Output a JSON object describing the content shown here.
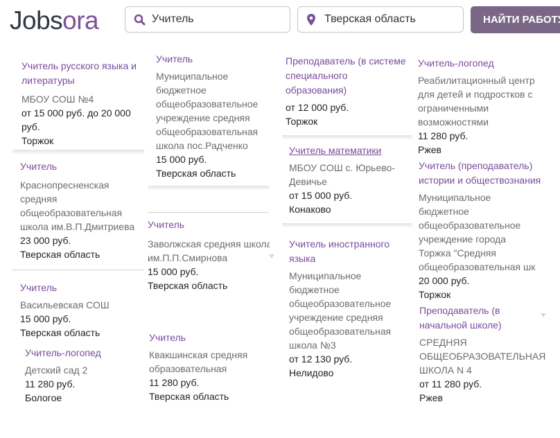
{
  "header": {
    "logo_part1": "Jobs",
    "logo_part2": "ora",
    "search_value": "Учитель",
    "location_value": "Тверская область",
    "find_button": "НАЙТИ РАБОТУ"
  },
  "columns": [
    [
      {
        "title_lines": [
          "Учитель русского языка и",
          "литературы"
        ],
        "org_lines": [
          "МБОУ СОШ №4"
        ],
        "salary_lines": [
          "от 15 000 руб. до 20 000",
          "руб."
        ],
        "city": "Торжок"
      },
      {
        "title_lines": [
          "Учитель"
        ],
        "org_lines": [
          "Краснопресненская",
          "средняя",
          "общеобразовательная",
          "школа им.В.П.Дмитриева"
        ],
        "salary_lines": [
          "23 000 руб."
        ],
        "city": "Тверская область"
      },
      {
        "title_lines": [
          "Учитель"
        ],
        "org_lines": [
          "Васильевская СОШ"
        ],
        "salary_lines": [
          "15 000 руб."
        ],
        "city": "Тверская область"
      },
      {
        "title_lines": [
          "Учитель-логопед"
        ],
        "org_lines": [
          "Детский сад 2"
        ],
        "salary_lines": [
          "11 280 руб."
        ],
        "city": "Бологое"
      }
    ],
    [
      {
        "title_lines": [
          "Учитель"
        ],
        "org_lines": [
          "Муниципальное",
          "бюджетное",
          "общеобразовательное",
          "учреждение средняя",
          "общеобразовательная",
          "школа пос.Радченко"
        ],
        "salary_lines": [
          "15 000 руб."
        ],
        "city": "Тверская область"
      },
      {
        "title_lines": [
          "Учитель"
        ],
        "org_lines": [
          "Заволжская средняя школа",
          "им.П.П.Смирнова"
        ],
        "salary_lines": [
          "15 000 руб."
        ],
        "city": "Тверская область"
      },
      {
        "title_lines": [
          "Учитель"
        ],
        "org_lines": [
          "Квакшинская средняя",
          "образовательная"
        ],
        "salary_lines": [
          "11 280 руб."
        ],
        "city": "Тверская область"
      }
    ],
    [
      {
        "title_lines": [
          "Преподаватель (в системе",
          "специального",
          "образования)"
        ],
        "org_lines": [],
        "salary_lines": [
          "от 12 000 руб."
        ],
        "city": "Торжок"
      },
      {
        "title_lines": [
          "Учитель математики"
        ],
        "org_lines": [
          "МБОУ СОШ с. Юрьево-",
          "Девичье"
        ],
        "salary_lines": [
          "от 15 000 руб."
        ],
        "city": "Конаково"
      },
      {
        "title_lines": [
          "Учитель иностранного",
          "языка"
        ],
        "org_lines": [
          "Муниципальное",
          "бюджетное",
          "общеобразовательное",
          "учреждение средняя",
          "общеобразовательная",
          "школа №3"
        ],
        "salary_lines": [
          "от 12 130 руб."
        ],
        "city": "Нелидово"
      }
    ],
    [
      {
        "title_lines": [
          "Учитель-логопед"
        ],
        "org_lines": [
          "Реабилитационный центр",
          "для детей и подростков с",
          "ограниченными",
          "возможностями"
        ],
        "salary_lines": [
          "11 280 руб."
        ],
        "city": "Ржев"
      },
      {
        "title_lines": [
          "Учитель (преподаватель)",
          "истории и обществознания"
        ],
        "org_lines": [
          "Муниципальное",
          "бюджетное",
          "общеобразовательное",
          "учреждение города",
          "Торжка \"Средняя",
          "общеобразовательная шк"
        ],
        "salary_lines": [
          "20 000 руб."
        ],
        "city": "Торжок"
      },
      {
        "title_lines": [
          "Преподаватель (в",
          "начальной школе)"
        ],
        "org_lines": [
          "СРЕДНЯЯ",
          "ОБЩЕОБРАЗОВАТЕЛЬНАЯ",
          "ШКОЛА N 4"
        ],
        "salary_lines": [
          "от 11 280 руб."
        ],
        "city": "Ржев"
      }
    ]
  ],
  "colors": {
    "brand_dark": "#333645",
    "brand_purple": "#7b5197",
    "button": "#7a6686",
    "link": "#7b4a9b"
  },
  "icons": {
    "search": "search-icon",
    "location": "location-pin-icon"
  }
}
